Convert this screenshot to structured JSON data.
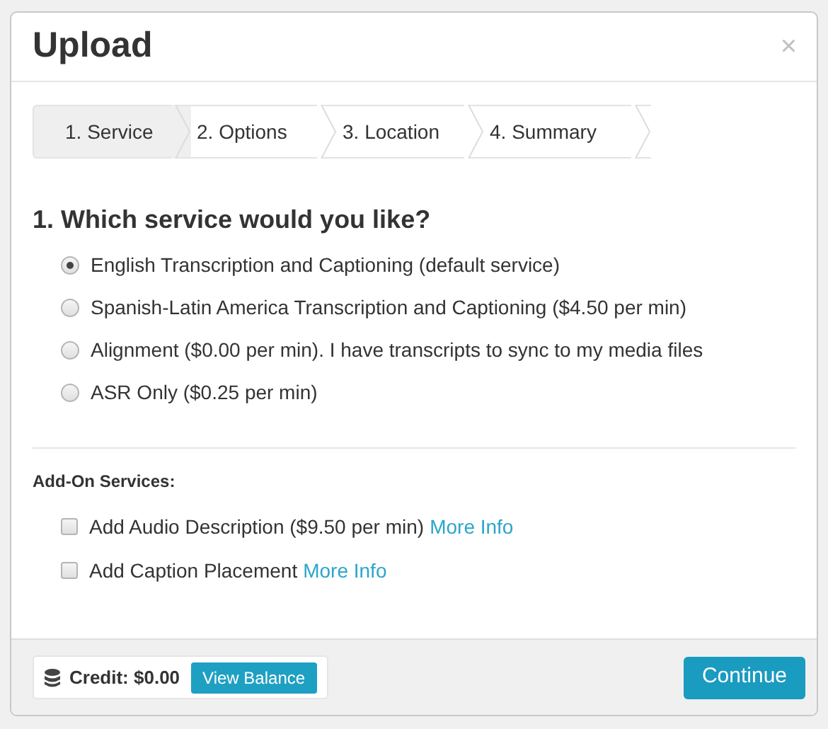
{
  "dialog": {
    "title": "Upload",
    "close": "×"
  },
  "steps": [
    {
      "label": "1. Service",
      "selected": true
    },
    {
      "label": "2. Options",
      "selected": false
    },
    {
      "label": "3. Location",
      "selected": false
    },
    {
      "label": "4. Summary",
      "selected": false
    }
  ],
  "question": "1. Which service would you like?",
  "services": [
    {
      "label": "English Transcription and Captioning (default service)",
      "selected": true
    },
    {
      "label": "Spanish-Latin America Transcription and Captioning ($4.50 per min)",
      "selected": false
    },
    {
      "label": "Alignment ($0.00 per min). I have transcripts to sync to my media files",
      "selected": false
    },
    {
      "label": "ASR Only ($0.25 per min)",
      "selected": false
    }
  ],
  "addons_heading": "Add-On Services:",
  "addons": [
    {
      "label": "Add Audio Description ($9.50 per min)",
      "link": "More Info",
      "checked": false
    },
    {
      "label": "Add Caption Placement",
      "link": "More Info",
      "checked": false
    }
  ],
  "footer": {
    "credit": "Credit: $0.00",
    "view_balance": "View Balance",
    "continue": "Continue"
  }
}
